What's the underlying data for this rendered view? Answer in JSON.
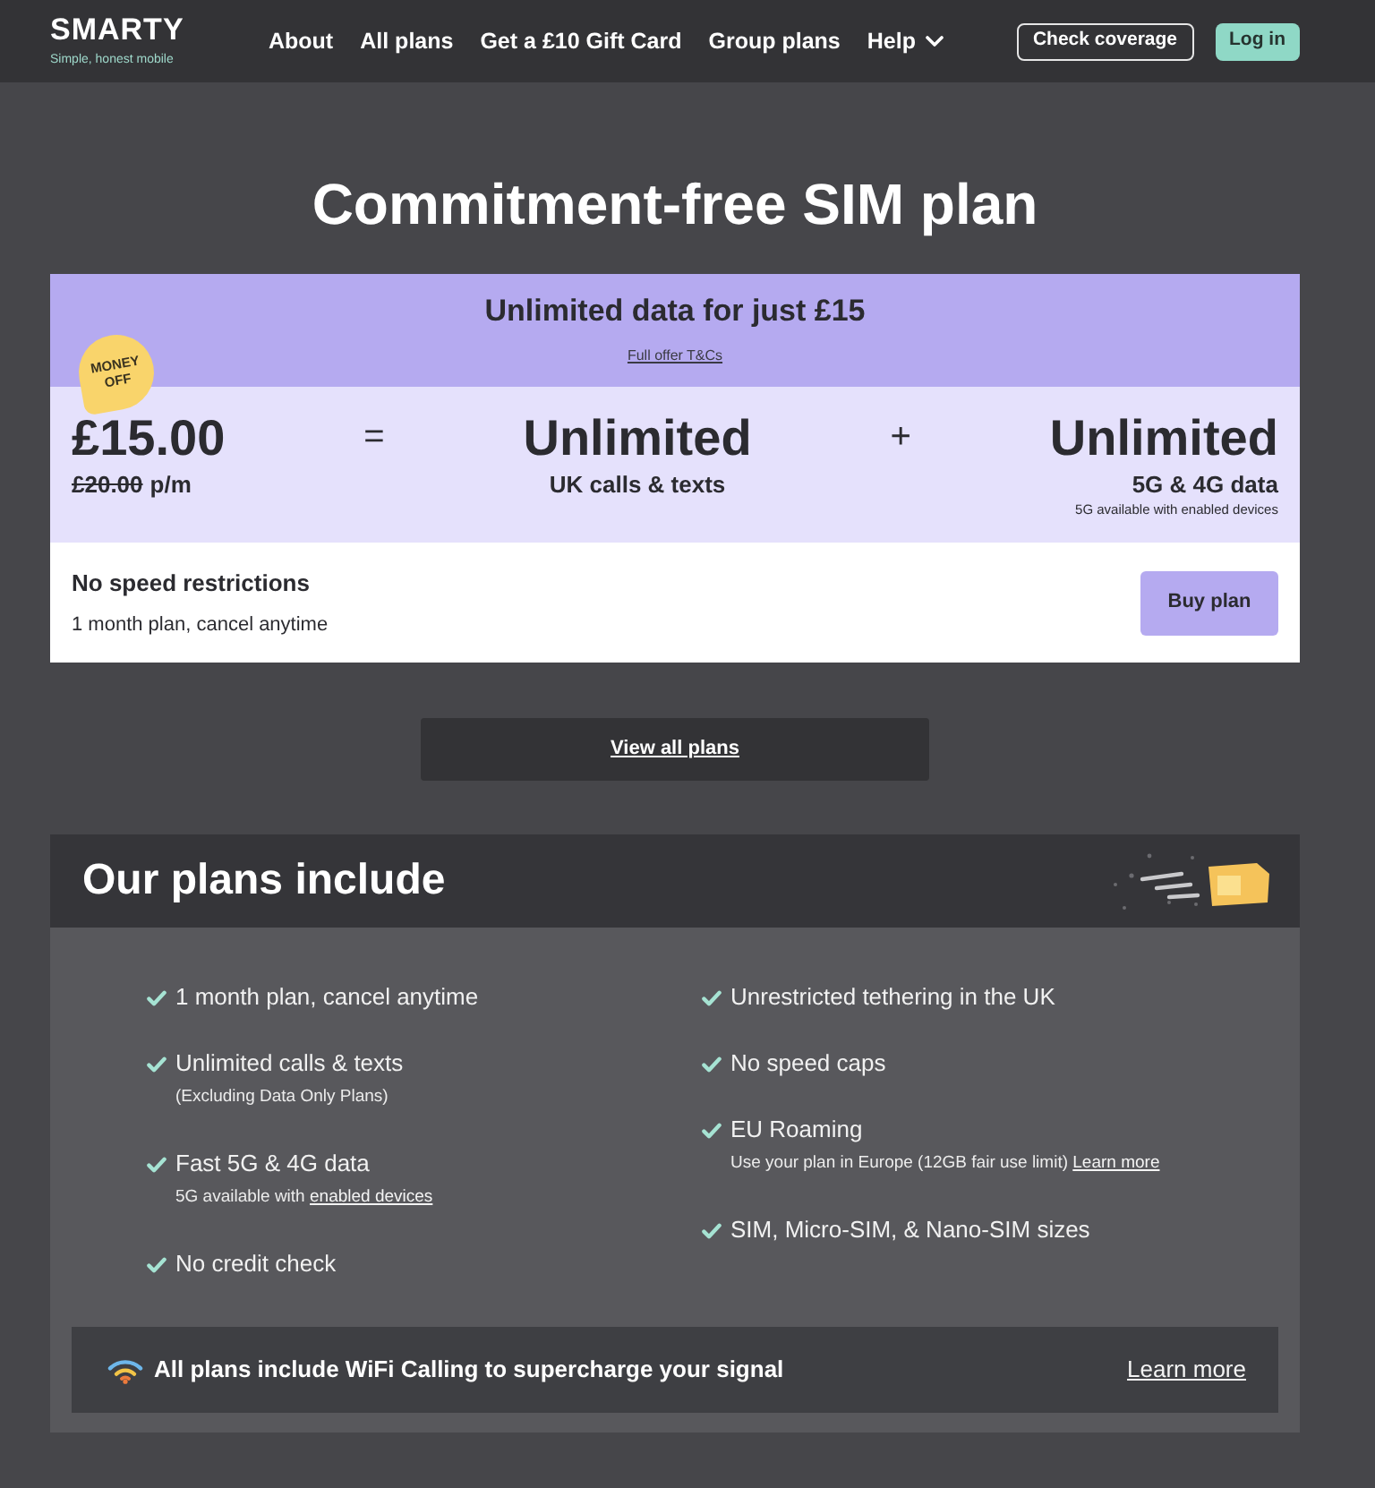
{
  "navbar": {
    "logo": "SMARTY",
    "tagline": "Simple, honest mobile",
    "links": [
      {
        "label": "About",
        "kind": "link"
      },
      {
        "label": "All plans",
        "kind": "link"
      },
      {
        "label": "Get a £10 Gift Card",
        "kind": "link"
      },
      {
        "label": "Group plans",
        "kind": "link"
      },
      {
        "label": "Help",
        "kind": "dropdown"
      }
    ],
    "buttons": [
      {
        "label": "Check coverage",
        "kind": "outline"
      },
      {
        "label": "Log in",
        "kind": "filled"
      }
    ]
  },
  "title": "Commitment-free SIM plan",
  "plan": {
    "headline": "Unlimited data for just £15",
    "terms_link": "Full offer T&Cs",
    "badge": "MONEY OFF",
    "price": "£15.00",
    "old_price": "£20.00",
    "price_unit": "p/m",
    "equals": "=",
    "calls": {
      "value": "Unlimited",
      "label": "UK calls & texts"
    },
    "plus": "+",
    "data": {
      "value": "Unlimited",
      "label": "5G & 4G data",
      "note": "5G available with enabled devices"
    },
    "feature": "No speed restrictions",
    "term": "1 month plan, cancel anytime",
    "button": "Buy plan"
  },
  "view_all_button": "View all plans",
  "includes": {
    "title": "Our plans include",
    "columns": [
      [
        {
          "text": "1 month plan, cancel anytime"
        },
        {
          "text": "Unlimited calls & texts",
          "note": "(Excluding Data Only Plans)"
        },
        {
          "text": "Fast 5G & 4G data",
          "note": "5G available with",
          "note_link": "enabled devices"
        },
        {
          "text": "No credit check"
        }
      ],
      [
        {
          "text": "Unrestricted tethering in the UK"
        },
        {
          "text": "No speed caps"
        },
        {
          "text": "EU Roaming",
          "note": "Use your plan in Europe (12GB fair use limit)",
          "note_link": "Learn more"
        },
        {
          "text": "SIM, Micro-SIM, & Nano-SIM sizes"
        }
      ]
    ],
    "banner": {
      "text": "All plans include WiFi Calling to supercharge your signal",
      "link": "Learn more"
    }
  }
}
